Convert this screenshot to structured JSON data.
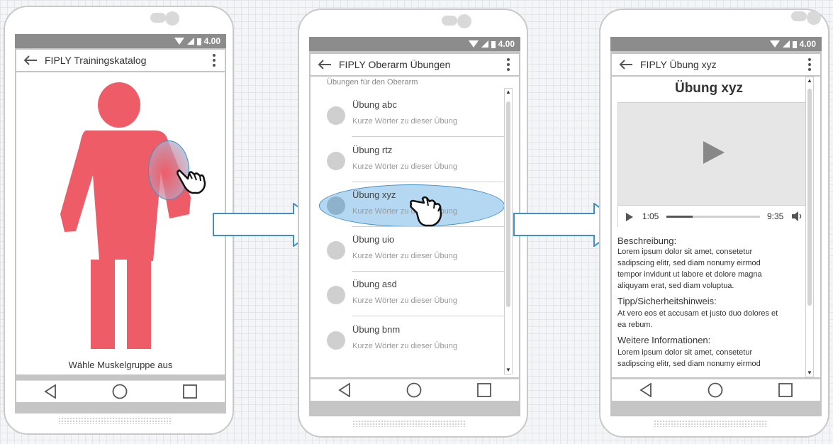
{
  "phones": {
    "left": {
      "status_time": "4.00",
      "app_title": "FIPLY Trainingskatalog",
      "caption": "Wähle Muskelgruppe aus"
    },
    "middle": {
      "status_time": "4.00",
      "app_title": "FIPLY Oberarm Übungen",
      "section_label": "Übungen für den Oberarm",
      "items": [
        {
          "title": "Übung abc",
          "subtitle": "Kurze Wörter zu dieser Übung"
        },
        {
          "title": "Übung rtz",
          "subtitle": "Kurze Wörter zu dieser Übung"
        },
        {
          "title": "Übung xyz",
          "subtitle": "Kurze Wörter zu dieser Übung"
        },
        {
          "title": "Übung uio",
          "subtitle": "Kurze Wörter zu dieser Übung"
        },
        {
          "title": "Übung asd",
          "subtitle": "Kurze Wörter zu dieser Übung"
        },
        {
          "title": "Übung bnm",
          "subtitle": "Kurze Wörter zu dieser Übung"
        }
      ]
    },
    "right": {
      "status_time": "4.00",
      "app_title": "FIPLY Übung xyz",
      "heading": "Übung xyz",
      "video": {
        "current_time": "1:05",
        "total_time": "9:35",
        "progress": 0.28
      },
      "description_label": "Beschreibung:",
      "description_text": "Lorem ipsum dolor sit amet, consetetur sadipscing elitr, sed diam nonumy eirmod tempor invidunt ut labore et dolore magna aliquyam erat, sed diam voluptua.",
      "tip_label": "Tipp/Sicherheitshinweis:",
      "tip_text": "At vero eos et accusam et justo duo dolores et ea rebum.",
      "more_label": "Weitere Informationen:",
      "more_text": "Lorem ipsum dolor sit amet, consetetur sadipscing elitr, sed diam nonumy eirmod"
    }
  },
  "colors": {
    "figure": "#ee5c68",
    "highlight": "#9fcdee",
    "arrow_stroke": "#3f8ec8",
    "statusbar": "#8c8c8c"
  }
}
